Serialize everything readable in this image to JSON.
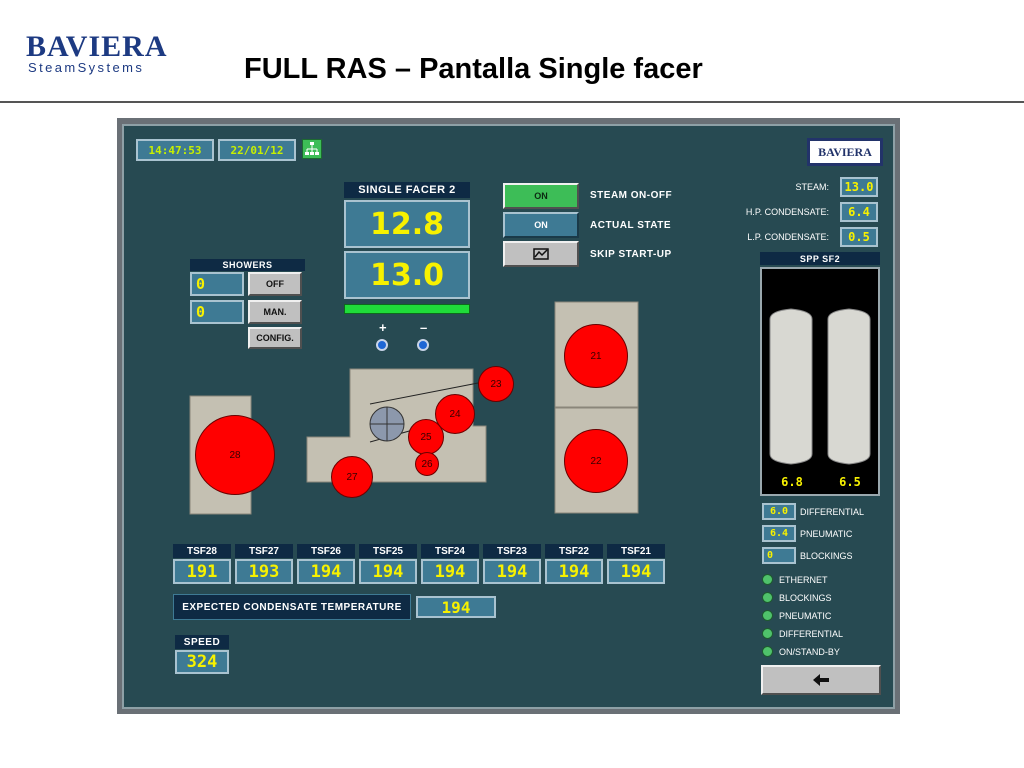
{
  "slide": {
    "logo_top": "BAVIERA",
    "logo_bottom": "SteamSystems",
    "title": "FULL RAS – Pantalla Single facer"
  },
  "hmi": {
    "time": "14:47:53",
    "date": "22/01/12",
    "network_icon": "network-icon",
    "brand_badge": "BAVIERA",
    "single_facer": {
      "title": "SINGLE FACER 2",
      "value_top": "12.8",
      "value_bottom": "13.0",
      "plus_label": "+",
      "minus_label": "–"
    },
    "steam_controls": [
      {
        "button": "ON",
        "label": "STEAM ON-OFF",
        "color": "#3dbd57"
      },
      {
        "button": "ON",
        "label": "ACTUAL STATE",
        "color": "#3e7a94"
      },
      {
        "button": "",
        "icon": "chart-icon",
        "label": "SKIP START-UP",
        "color": "#c0c0c0"
      }
    ],
    "showers": {
      "title": "SHOWERS",
      "rows": [
        {
          "value": "0",
          "button": "OFF"
        },
        {
          "value": "0",
          "button": "MAN."
        }
      ],
      "config_button": "CONFIG."
    },
    "pressures": [
      {
        "label": "STEAM:",
        "value": "13.0"
      },
      {
        "label": "H.P. CONDENSATE:",
        "value": "6.4"
      },
      {
        "label": "L.P. CONDENSATE:",
        "value": "0.5"
      }
    ],
    "spp": {
      "title": "SPP SF2",
      "left_value": "6.8",
      "right_value": "6.5"
    },
    "readouts": [
      {
        "value": "6.0",
        "label": "DIFFERENTIAL"
      },
      {
        "value": "6.4",
        "label": "PNEUMATIC"
      },
      {
        "value": "0",
        "label": "BLOCKINGS"
      }
    ],
    "status_leds": [
      "ETHERNET",
      "BLOCKINGS",
      "PNEUMATIC",
      "DIFFERENTIAL",
      "ON/STAND-BY"
    ],
    "back_icon": "arrow-left-icon",
    "rolls": [
      "21",
      "22",
      "23",
      "24",
      "25",
      "26",
      "27",
      "28"
    ],
    "tsf": [
      {
        "name": "TSF28",
        "value": "191"
      },
      {
        "name": "TSF27",
        "value": "193"
      },
      {
        "name": "TSF26",
        "value": "194"
      },
      {
        "name": "TSF25",
        "value": "194"
      },
      {
        "name": "TSF24",
        "value": "194"
      },
      {
        "name": "TSF23",
        "value": "194"
      },
      {
        "name": "TSF22",
        "value": "194"
      },
      {
        "name": "TSF21",
        "value": "194"
      }
    ],
    "expected": {
      "label": "EXPECTED CONDENSATE TEMPERATURE",
      "value": "194"
    },
    "speed": {
      "label": "SPEED",
      "value": "324"
    },
    "colors": {
      "background": "#274a52",
      "roll": "#ff0000",
      "value_text": "#f7f100",
      "led": "#4fc26b"
    }
  }
}
